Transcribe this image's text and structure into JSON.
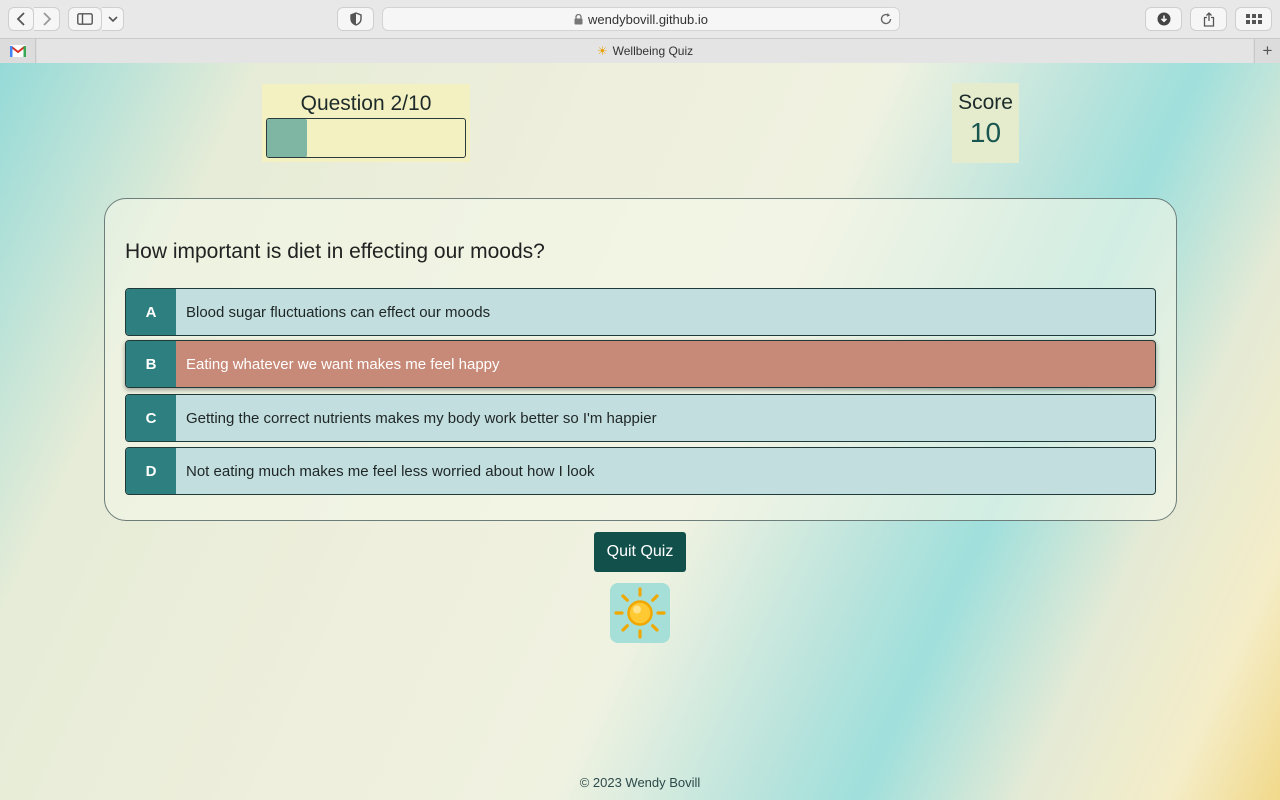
{
  "browser": {
    "url": "wendybovill.github.io",
    "tab_title": "Wellbeing Quiz"
  },
  "quiz": {
    "progress_label": "Question 2/10",
    "progress_fraction": 0.2,
    "score_label": "Score",
    "score_value": "10",
    "question": "How important is diet in effecting our moods?",
    "answers": [
      {
        "letter": "A",
        "text": "Blood sugar fluctuations can effect our moods",
        "state": "default"
      },
      {
        "letter": "B",
        "text": "Eating whatever we want makes me feel happy",
        "state": "wrong"
      },
      {
        "letter": "C",
        "text": "Getting the correct nutrients makes my body work better so I'm happier",
        "state": "default"
      },
      {
        "letter": "D",
        "text": "Not eating much makes me feel less worried about how I look",
        "state": "default"
      }
    ],
    "quit_label": "Quit Quiz"
  },
  "colors": {
    "letter_bg": "#2e7f80",
    "answer_bg": "#c2dede",
    "wrong_bg": "#c88a78",
    "quit_bg": "#12504c",
    "progress_fill": "#7fb5a3"
  },
  "icons": {
    "logo": "sun-icon",
    "favicon": "sun-icon"
  },
  "footer": {
    "copyright": "© 2023 Wendy Bovill"
  }
}
